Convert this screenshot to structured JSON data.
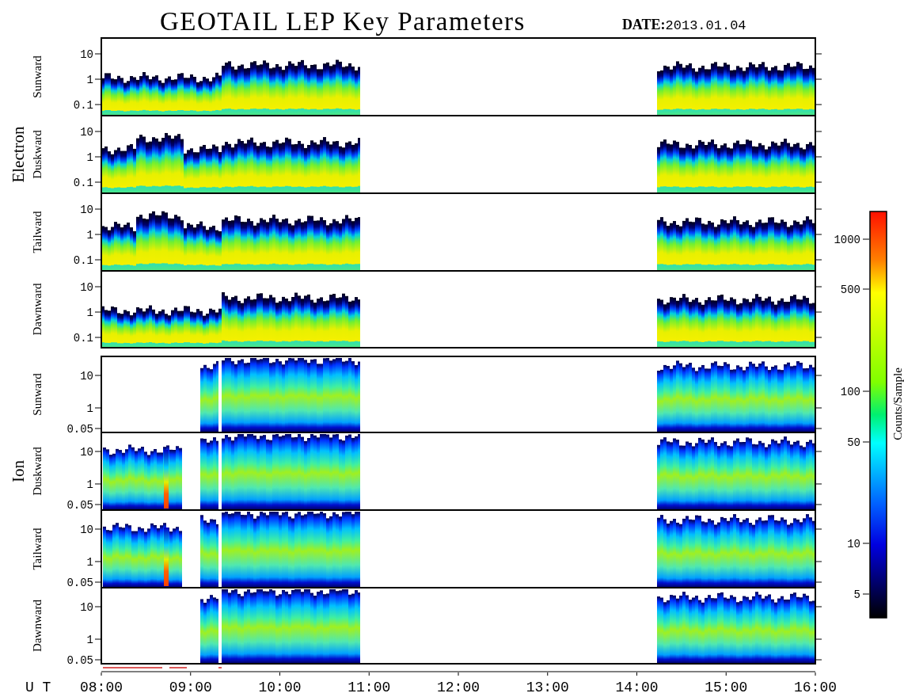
{
  "title": "GEOTAIL LEP Key Parameters",
  "date": {
    "label": "DATE:",
    "value": "2013.01.04"
  },
  "groups": [
    {
      "label": "Electron",
      "kind": "electron",
      "panels": [
        {
          "label": "Sunward",
          "yticks": [
            "10",
            "1",
            "0.1"
          ]
        },
        {
          "label": "Duskward",
          "yticks": [
            "10",
            "1",
            "0.1"
          ]
        },
        {
          "label": "Tailward",
          "yticks": [
            "10",
            "1",
            "0.1"
          ]
        },
        {
          "label": "Dawnward",
          "yticks": [
            "10",
            "1",
            "0.1"
          ]
        }
      ]
    },
    {
      "label": "Ion",
      "kind": "ion",
      "panels": [
        {
          "label": "Sunward",
          "yticks": [
            "10",
            "1",
            "0.05"
          ]
        },
        {
          "label": "Duskward",
          "yticks": [
            "10",
            "1",
            "0.05"
          ]
        },
        {
          "label": "Tailward",
          "yticks": [
            "10",
            "1",
            "0.05"
          ]
        },
        {
          "label": "Dawnward",
          "yticks": [
            "10",
            "1",
            "0.05"
          ]
        }
      ]
    }
  ],
  "time_axis": {
    "label": "U T",
    "ticks": [
      "08:00",
      "09:00",
      "10:00",
      "11:00",
      "12:00",
      "13:00",
      "14:00",
      "15:00",
      "16:00"
    ]
  },
  "colorbar": {
    "label": "Counts/Sample",
    "ticks": [
      "1000",
      "500",
      "100",
      "50",
      "10",
      "5"
    ]
  }
}
